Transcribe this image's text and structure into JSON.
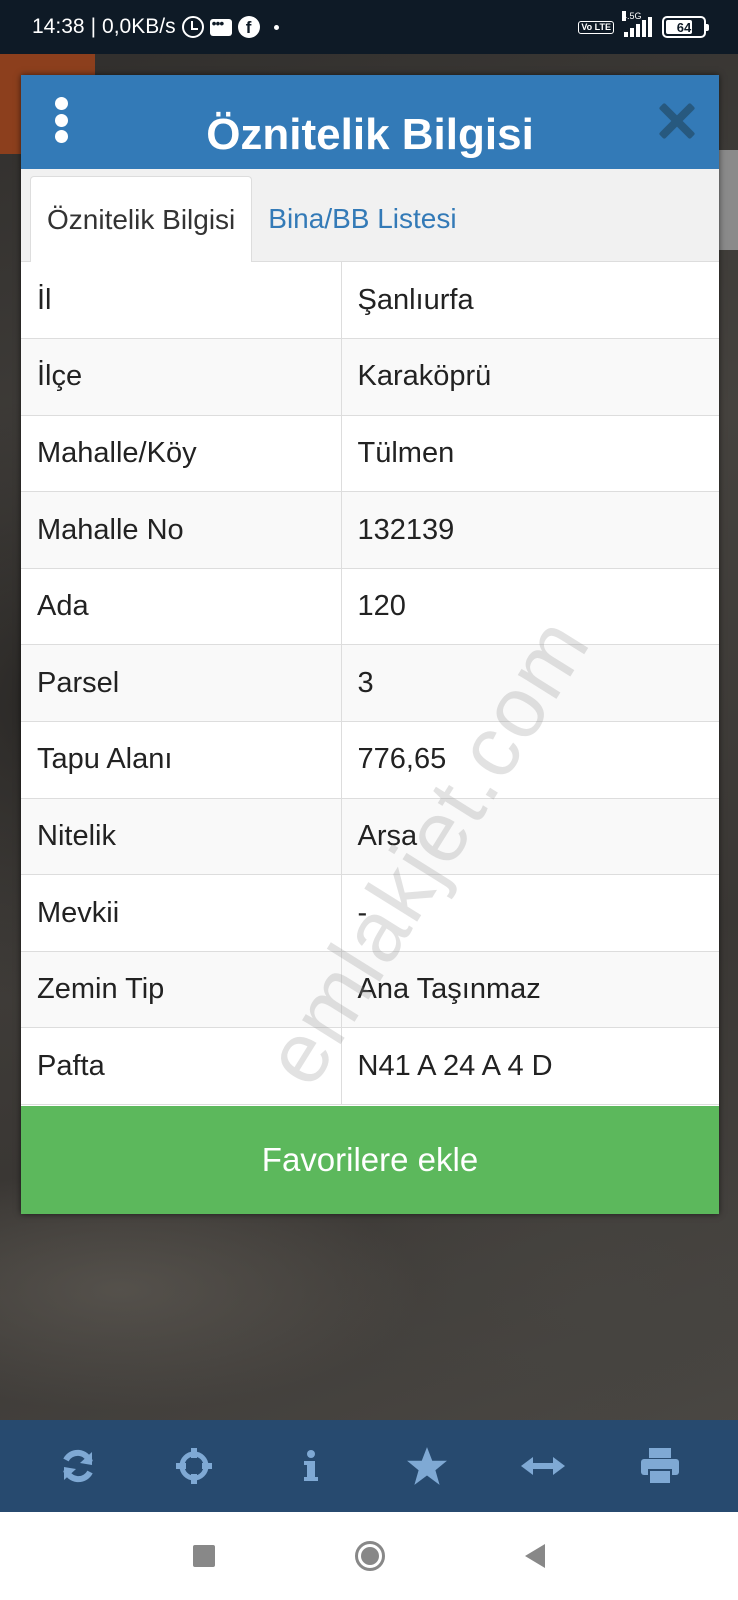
{
  "status_bar": {
    "time": "14:38",
    "separator": "|",
    "speed": "0,0KB/s",
    "network": "4.5G",
    "volte": "Vo LTE",
    "battery": "64"
  },
  "dialog": {
    "title": "Öznitelik Bilgisi",
    "tabs": [
      {
        "label": "Öznitelik Bilgisi",
        "active": true
      },
      {
        "label": "Bina/BB Listesi",
        "active": false
      }
    ],
    "rows": [
      {
        "key": "İl",
        "value": "Şanlıurfa"
      },
      {
        "key": "İlçe",
        "value": "Karaköprü"
      },
      {
        "key": "Mahalle/Köy",
        "value": "Tülmen"
      },
      {
        "key": "Mahalle No",
        "value": "132139"
      },
      {
        "key": "Ada",
        "value": "120"
      },
      {
        "key": "Parsel",
        "value": "3"
      },
      {
        "key": "Tapu Alanı",
        "value": "776,65"
      },
      {
        "key": "Nitelik",
        "value": "Arsa"
      },
      {
        "key": "Mevkii",
        "value": "-"
      },
      {
        "key": "Zemin Tip",
        "value": "Ana Taşınmaz"
      },
      {
        "key": "Pafta",
        "value": "N41 A 24 A 4 D"
      }
    ],
    "favorite_button": "Favorilere ekle"
  },
  "watermark": "emlakjet.com",
  "toolbar": {
    "icons": [
      "refresh-icon",
      "crosshair-icon",
      "info-icon",
      "star-icon",
      "measure-icon",
      "print-icon"
    ],
    "icon_color": "#7fa9d4"
  },
  "colors": {
    "header": "#337ab7",
    "favorite": "#5cb85c",
    "toolbar": "#274a6f"
  }
}
